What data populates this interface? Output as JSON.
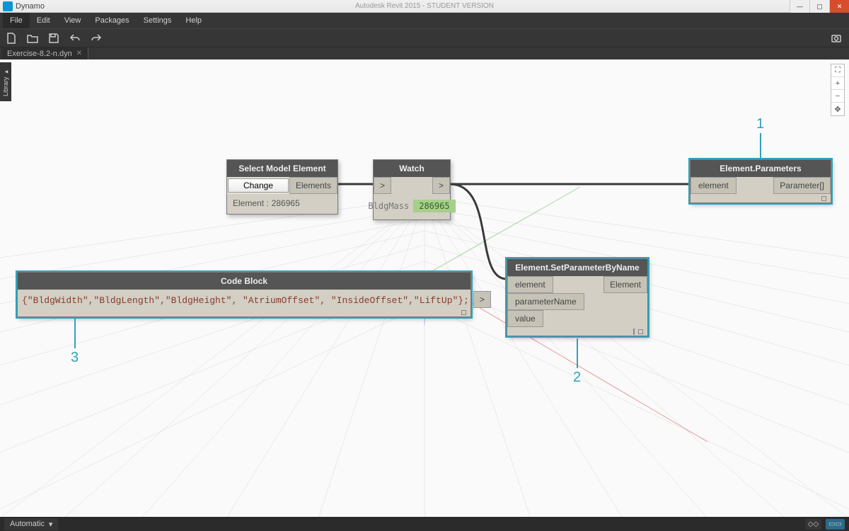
{
  "titlebar": {
    "app": "Dynamo",
    "subtitle": "Autodesk Revit 2015 - STUDENT VERSION"
  },
  "menu": {
    "file": "File",
    "edit": "Edit",
    "view": "View",
    "packages": "Packages",
    "settings": "Settings",
    "help": "Help"
  },
  "tab": {
    "name": "Exercise-8.2-n.dyn"
  },
  "library": {
    "label": "Library ▸"
  },
  "annotations": {
    "one": "1",
    "two": "2",
    "three": "3"
  },
  "nodes": {
    "select": {
      "title": "Select Model Element",
      "change": "Change",
      "outport": "Elements",
      "info_label": "Element :",
      "info_val": "286965"
    },
    "watch": {
      "title": "Watch",
      "in": ">",
      "out": ">",
      "label": "BldgMass",
      "value": "286965"
    },
    "params": {
      "title": "Element.Parameters",
      "in": "element",
      "out": "Parameter[]"
    },
    "setparam": {
      "title": "Element.SetParameterByName",
      "in1": "element",
      "in2": "parameterName",
      "in3": "value",
      "out": "Element"
    },
    "codeblock": {
      "title": "Code Block",
      "code": "{\"BldgWidth\",\"BldgLength\",\"BldgHeight\", \"AtriumOffset\", \"InsideOffset\",\"LiftUp\"};",
      "out": ">"
    }
  },
  "statusbar": {
    "mode": "Automatic",
    "caret": "▾"
  }
}
